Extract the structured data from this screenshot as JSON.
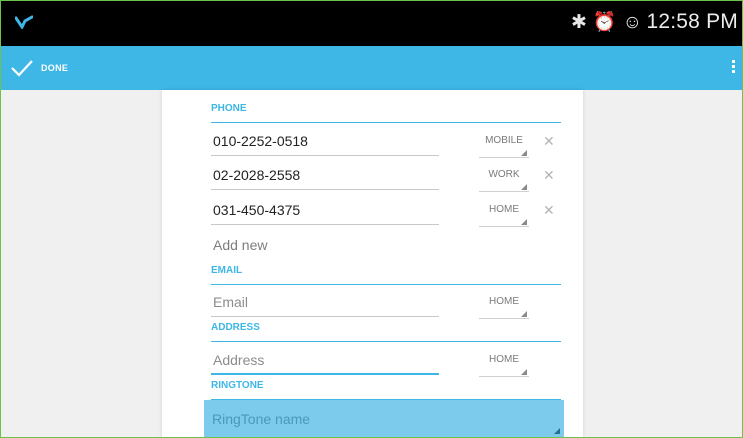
{
  "status_bar": {
    "time": "12:58 PM",
    "icons": [
      "bluetooth-icon",
      "alarm-icon",
      "google-account-icon"
    ],
    "bluetooth_glyph": "✱",
    "alarm_glyph": "⏰",
    "account_glyph": "☺"
  },
  "action_bar": {
    "done_label": "DONE",
    "accent": "#3eb6e6"
  },
  "phone": {
    "header": "PHONE",
    "entries": [
      {
        "number": "010-2252-0518",
        "type": "MOBILE"
      },
      {
        "number": "02-2028-2558",
        "type": "WORK"
      },
      {
        "number": "031-450-4375",
        "type": "HOME"
      }
    ],
    "remove_glyph": "✕",
    "add_new": "Add new"
  },
  "email": {
    "header": "EMAIL",
    "placeholder": "Email",
    "type": "HOME"
  },
  "address": {
    "header": "ADDRESS",
    "placeholder": "Address",
    "type": "HOME"
  },
  "ringtone": {
    "header": "RINGTONE",
    "placeholder": "RingTone name"
  }
}
